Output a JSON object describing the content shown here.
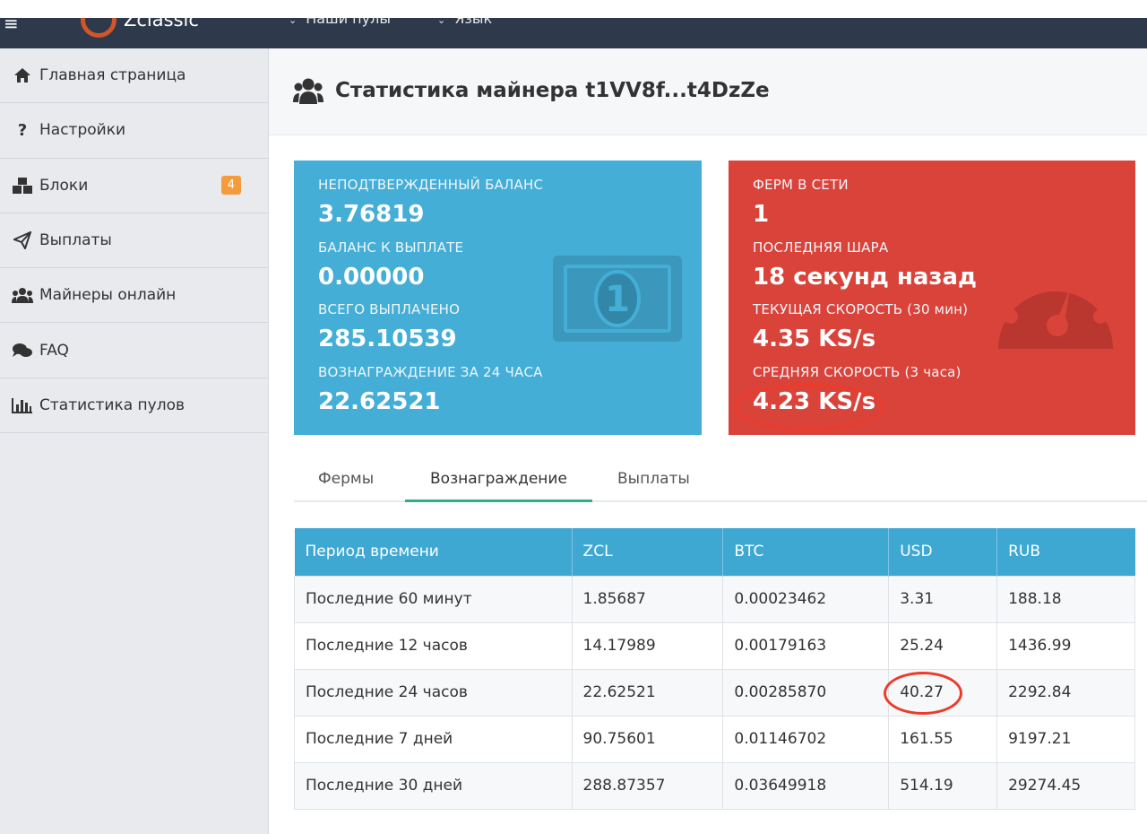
{
  "navbar": {
    "brand": "Zclassic",
    "menu": [
      "Наши пулы",
      "Язык"
    ]
  },
  "sidebar": {
    "items": [
      {
        "label": "Главная страница",
        "icon": "home-icon"
      },
      {
        "label": "Настройки",
        "icon": "question-icon"
      },
      {
        "label": "Блоки",
        "icon": "cubes-icon",
        "badge": "4"
      },
      {
        "label": "Выплаты",
        "icon": "paper-plane-icon"
      },
      {
        "label": "Майнеры онлайн",
        "icon": "users-icon"
      },
      {
        "label": "FAQ",
        "icon": "comments-icon"
      },
      {
        "label": "Статистика пулов",
        "icon": "bar-chart-icon"
      }
    ]
  },
  "page": {
    "title": "Статистика майнера t1VV8f...t4DzZe"
  },
  "balance_card": {
    "unconfirmed_label": "НЕПОДТВЕРЖДЕННЫЙ БАЛАНС",
    "unconfirmed_value": "3.76819",
    "payable_label": "БАЛАНС К ВЫПЛАТЕ",
    "payable_value": "0.00000",
    "paid_label": "ВСЕГО ВЫПЛАЧЕНО",
    "paid_value": "285.10539",
    "reward24_label": "ВОЗНАГРАЖДЕНИЕ ЗА 24 ЧАСА",
    "reward24_value": "22.62521"
  },
  "farm_card": {
    "online_label": "ФЕРМ В СЕТИ",
    "online_value": "1",
    "last_share_label": "ПОСЛЕДНЯЯ ШАРА",
    "last_share_value": "18 секунд назад",
    "current_speed_label": "ТЕКУЩАЯ СКОРОСТЬ (30 мин)",
    "current_speed_value": "4.35 KS/s",
    "avg_speed_label": "СРЕДНЯЯ СКОРОСТЬ (3 часа)",
    "avg_speed_value": "4.23 KS/s"
  },
  "tabs": [
    {
      "label": "Фермы",
      "active": false
    },
    {
      "label": "Вознаграждение",
      "active": true
    },
    {
      "label": "Выплаты",
      "active": false
    }
  ],
  "table": {
    "headers": [
      "Период времени",
      "ZCL",
      "BTC",
      "USD",
      "RUB"
    ],
    "rows": [
      [
        "Последние 60 минут",
        "1.85687",
        "0.00023462",
        "3.31",
        "188.18"
      ],
      [
        "Последние 12 часов",
        "14.17989",
        "0.00179163",
        "25.24",
        "1436.99"
      ],
      [
        "Последние 24 часов",
        "22.62521",
        "0.00285870",
        "40.27",
        "2292.84"
      ],
      [
        "Последние 7 дней",
        "90.75601",
        "0.01146702",
        "161.55",
        "9197.21"
      ],
      [
        "Последние 30 дней",
        "288.87357",
        "0.03649918",
        "514.19",
        "29274.45"
      ]
    ]
  },
  "colors": {
    "navbar": "#2e3a4b",
    "card_blue": "#44aed6",
    "card_red": "#d9433a",
    "table_header": "#3fa8d2",
    "tab_active": "#2fae8c",
    "badge": "#f39c3c",
    "annotation": "#ec3b2c"
  }
}
